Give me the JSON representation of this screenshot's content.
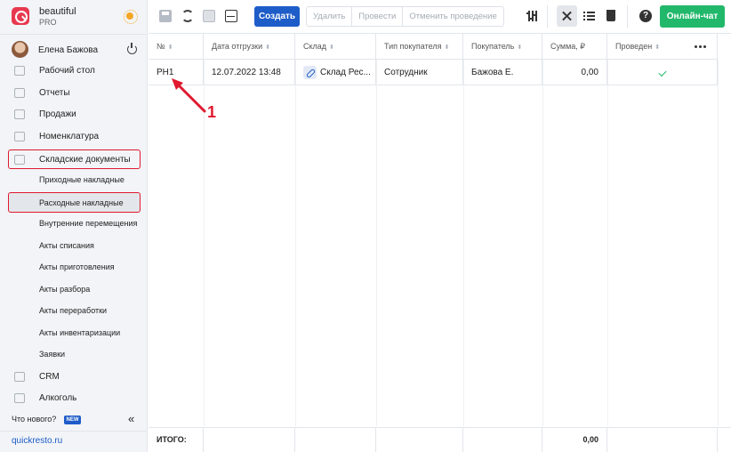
{
  "brand": {
    "name": "beautiful",
    "plan": "PRO"
  },
  "user": {
    "name": "Елена Бажова"
  },
  "nav": {
    "items": [
      {
        "label": "Рабочий стол",
        "icon": "dashboard-icon"
      },
      {
        "label": "Отчеты",
        "icon": "chart-icon"
      },
      {
        "label": "Продажи",
        "icon": "basket-icon"
      },
      {
        "label": "Номенклатура",
        "icon": "tag-icon"
      },
      {
        "label": "Складские документы",
        "icon": "box-icon"
      }
    ],
    "sub_items": [
      "Приходные накладные",
      "Расходные накладные",
      "Внутренние перемещения",
      "Акты списания",
      "Акты приготовления",
      "Акты разбора",
      "Акты переработки",
      "Акты инвентаризации",
      "Заявки"
    ],
    "bottom_items": [
      {
        "label": "CRM",
        "icon": "crm-icon"
      },
      {
        "label": "Алкоголь",
        "icon": "glass-icon"
      }
    ],
    "whats_new": "Что нового?",
    "new_badge": "NEW",
    "site": "quickresto.ru"
  },
  "toolbar": {
    "create": "Создать",
    "delete": "Удалить",
    "post": "Провести",
    "unpost": "Отменить проведение",
    "chat": "Онлайн-чат",
    "help": "?"
  },
  "table": {
    "columns": [
      "№",
      "Дата отгрузки",
      "Склад",
      "Тип покупателя",
      "Покупатель",
      "Сумма, ₽",
      "Проведен"
    ],
    "rows": [
      {
        "number": "РН1",
        "date": "12.07.2022 13:48",
        "warehouse": "Склад Рес...",
        "buyer_type": "Сотрудник",
        "buyer": "Бажова Е.",
        "sum": "0,00",
        "posted": true
      }
    ],
    "footer_label": "ИТОГО:",
    "footer_sum": "0,00"
  },
  "annotation": {
    "number": "1",
    "color": "#e0192f"
  },
  "colors": {
    "accent": "#1e5cc8",
    "chat": "#22b86b",
    "highlight": "#e0192f"
  }
}
